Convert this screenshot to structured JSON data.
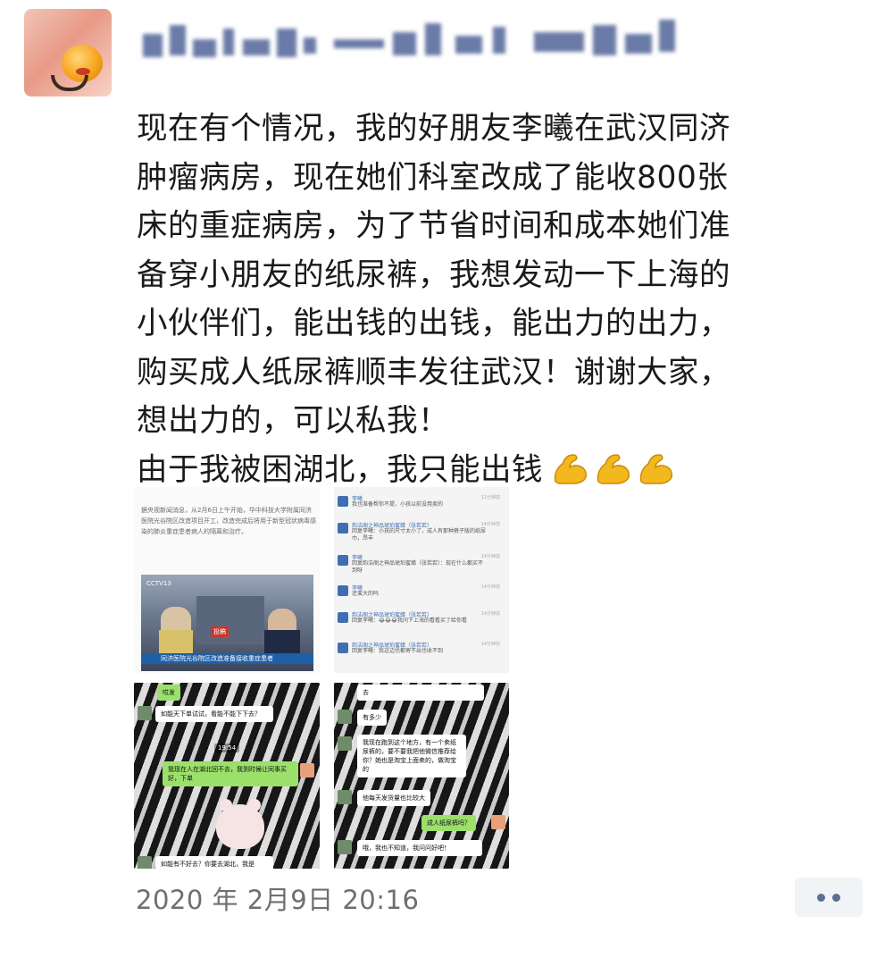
{
  "post": {
    "author_avatar_alt": "avatar",
    "lines": [
      "现在有个情况，我的好朋友李曦在武汉同济",
      "肿瘤病房，现在她们科室改成了能收800张",
      "床的重症病房，为了节省时间和成本她们准",
      "备穿小朋友的纸尿裤，我想发动一下上海的",
      "小伙伴们，能出钱的出钱，能出力的出力，",
      "购买成人纸尿裤顺丰发往武汉！谢谢大家，",
      "想出力的，可以私我！",
      "由于我被困湖北，我只能出钱"
    ],
    "emoji_icons": [
      "flexed-biceps-icon",
      "flexed-biceps-icon",
      "flexed-biceps-icon"
    ],
    "timestamp": "2020 年 2月9日 20:16"
  },
  "thumbnails": {
    "news": {
      "text": "据央视新闻消息，从2月6日上午开始，华中科技大学附属同济医院光谷院区改造项目开工，改造完成后将用于新型冠状病毒感染的肺炎重症患者病人的隔离和治疗。",
      "tv_logo": "CCTV13",
      "tv_tag": "投稿",
      "ticker": "同济医院光谷院区改造准备接收重症患者"
    },
    "chat_list": [
      {
        "name": "李曦",
        "message": "我也准备帮你不提，小孩以前没用卖的",
        "time": "12分钟前"
      },
      {
        "name": "韵洁阁之神品琥珀蜜蜡（张若若）",
        "message": "回复李曦：小孩的尺寸太小了，成人有那种裤子版的纸尿巾，昂丰",
        "time": "14分钟前"
      },
      {
        "name": "李曦",
        "message": "回复韵洁阁之神品琥珀蜜蜡（张若若）：现在什么都买不到呀",
        "time": "14分钟前"
      },
      {
        "name": "李曦",
        "message": "还蛮大的吗",
        "time": "14分钟前"
      },
      {
        "name": "韵洁阁之神品琥珀蜜蜡（张若若）",
        "message": "回复李曦：😂😂😂我问下上海的看看买了给你看",
        "time": "14分钟前"
      },
      {
        "name": "韵洁阁之神品琥珀蜜蜡（张若若）",
        "message": "回复李曦：我这边也都寄不出也收不到",
        "time": "14分钟前"
      }
    ],
    "chat_a": {
      "top": "哎发",
      "msg1": "如能天下单试试，看能不能下下去？",
      "time": "19:54",
      "msg2": "我现在人在湖北回不去，我到时候让同事买好，下单",
      "bottom": "如能有不好去？你要去湖北，我是"
    },
    "chat_b": {
      "top": "去",
      "msg1": "有多少",
      "msg2": "我现在跑到这个地方，有一个卖纸尿裤的，要不要我把他微信推荐给你？她也是淘宝上面卖的，做淘宝的",
      "msg3": "他每天发货量也比较大",
      "msg4": "成人纸尿裤吗？",
      "msg5": "哦，我也不知道，我问问好吧！"
    }
  }
}
